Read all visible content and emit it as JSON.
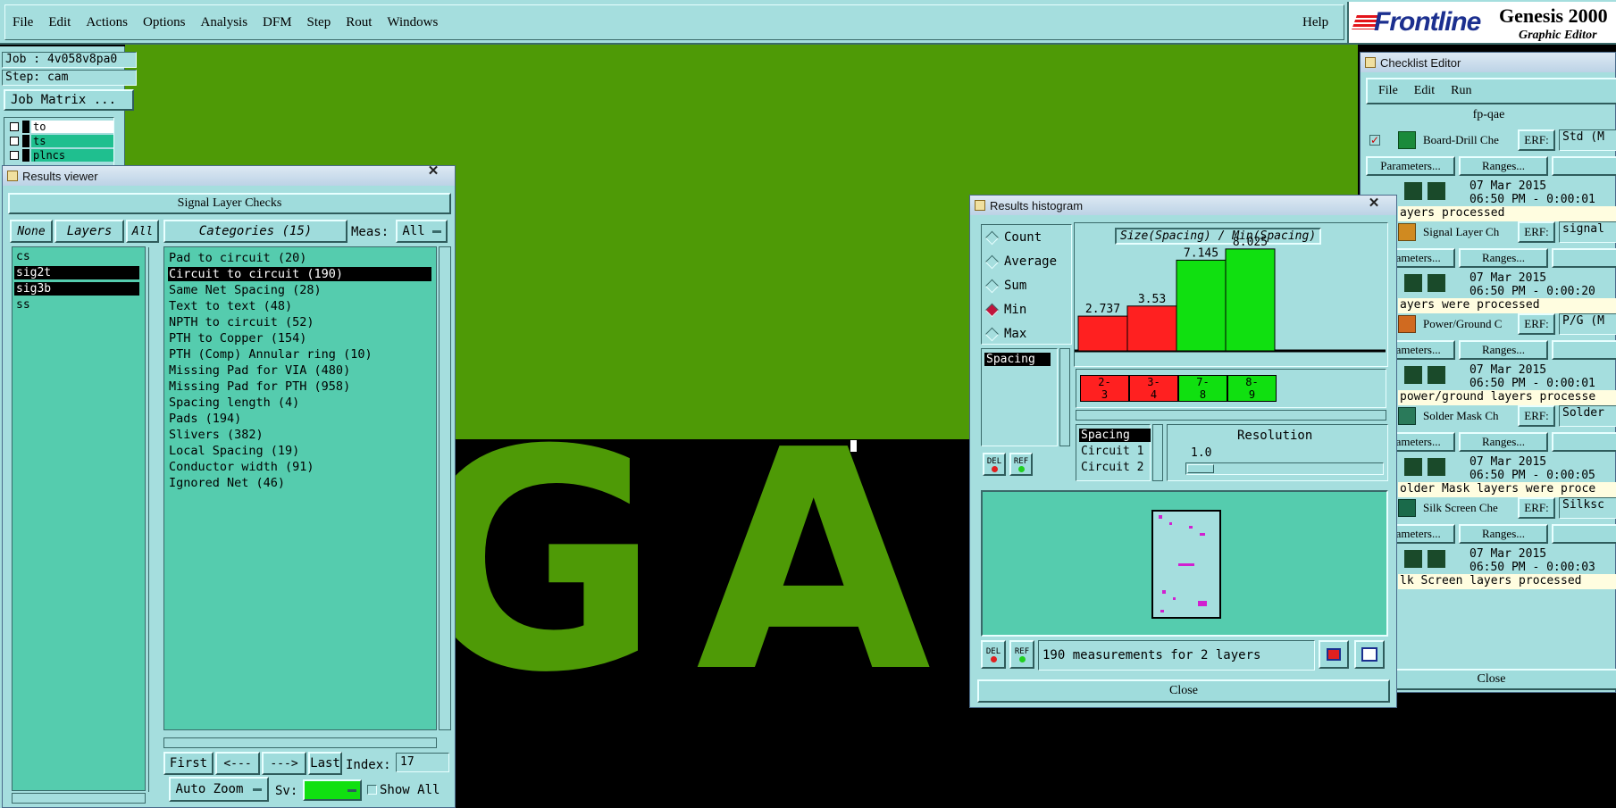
{
  "menubar": {
    "items": [
      "File",
      "Edit",
      "Actions",
      "Options",
      "Analysis",
      "DFM",
      "Step",
      "Rout",
      "Windows"
    ],
    "help": "Help",
    "logo": "Frontline",
    "product": "Genesis 2000",
    "subtitle": "Graphic Editor"
  },
  "left_panel": {
    "job": "Job : 4v058v8pa0",
    "step": "Step: cam",
    "job_matrix_button": "Job Matrix ...",
    "layers": [
      "to",
      "ts",
      "plncs"
    ]
  },
  "canvas": {
    "text": "GA1",
    "board_color": "#4e9a06"
  },
  "results_viewer": {
    "title": "Results viewer",
    "header": "Signal Layer Checks",
    "none_btn": "None",
    "layers_btn": "Layers",
    "all_btn": "All",
    "categories_btn": "Categories (15)",
    "meas_label": "Meas:",
    "meas_value": "All",
    "layer_list": [
      {
        "name": "cs",
        "selected": false
      },
      {
        "name": "sig2t",
        "selected": true
      },
      {
        "name": "sig3b",
        "selected": true
      },
      {
        "name": "ss",
        "selected": false
      }
    ],
    "categories": [
      {
        "label": "Pad to circuit (20)",
        "selected": false
      },
      {
        "label": "Circuit to circuit (190)",
        "selected": true
      },
      {
        "label": "Same Net Spacing (28)",
        "selected": false
      },
      {
        "label": "Text to text (48)",
        "selected": false
      },
      {
        "label": "NPTH to circuit (52)",
        "selected": false
      },
      {
        "label": "PTH to Copper (154)",
        "selected": false
      },
      {
        "label": "PTH (Comp) Annular ring (10)",
        "selected": false
      },
      {
        "label": "Missing Pad for VIA (480)",
        "selected": false
      },
      {
        "label": "Missing Pad for PTH (958)",
        "selected": false
      },
      {
        "label": "Spacing length (4)",
        "selected": false
      },
      {
        "label": "Pads (194)",
        "selected": false
      },
      {
        "label": "Slivers (382)",
        "selected": false
      },
      {
        "label": "Local Spacing (19)",
        "selected": false
      },
      {
        "label": "Conductor width (91)",
        "selected": false
      },
      {
        "label": "Ignored Net (46)",
        "selected": false
      }
    ],
    "nav": {
      "first": "First",
      "prev": "<---",
      "next": "--->",
      "last": "Last",
      "index_label": "Index:",
      "index_value": "17"
    },
    "auto_zoom": "Auto Zoom",
    "sv_label": "Sv:",
    "show_all": "Show All"
  },
  "histogram": {
    "title": "Results histogram",
    "modes": [
      {
        "label": "Count",
        "selected": false
      },
      {
        "label": "Average",
        "selected": false
      },
      {
        "label": "Sum",
        "selected": false
      },
      {
        "label": "Min",
        "selected": true
      },
      {
        "label": "Max",
        "selected": false
      }
    ],
    "spacing_list": [
      "Spacing"
    ],
    "chart_title": "Size(Spacing) / Min(Spacing)",
    "del": "DEL",
    "ref": "REF",
    "meas_list": [
      "Spacing",
      "Circuit 1",
      "Circuit 2"
    ],
    "resolution_label": "Resolution",
    "resolution_value": "1.0",
    "status": "190 measurements for 2 layers",
    "close": "Close"
  },
  "chart_data": {
    "type": "bar",
    "title": "Size(Spacing) / Min(Spacing)",
    "categories": [
      "2-3",
      "3-4",
      "7-8",
      "8-9"
    ],
    "category_lines": [
      [
        "2-",
        "3"
      ],
      [
        "3-",
        "4"
      ],
      [
        "7-",
        "8"
      ],
      [
        "8-",
        "9"
      ]
    ],
    "values": [
      2.737,
      3.53,
      7.145,
      8.025
    ],
    "value_labels": [
      "2.737",
      "3.53",
      "7.145",
      "8.025"
    ],
    "colors": [
      "#ff2020",
      "#ff2020",
      "#10e010",
      "#10e010"
    ],
    "ylim": [
      0,
      9
    ]
  },
  "checklist": {
    "title": "Checklist Editor",
    "menu": [
      "File",
      "Edit",
      "Run"
    ],
    "name": "fp-qae",
    "erf_label": "ERF:",
    "parameters_btn": "Parameters...",
    "ranges_btn": "Ranges...",
    "items": [
      {
        "name": "Board-Drill Che",
        "erf": "Std (M",
        "date": "07 Mar 2015",
        "time": "06:50 PM - 0:00:01",
        "status": "ayers processed"
      },
      {
        "name": "Signal Layer Ch",
        "erf": "signal",
        "date": "07 Mar 2015",
        "time": "06:50 PM - 0:00:20",
        "status": "ayers were processed"
      },
      {
        "name": "Power/Ground C",
        "erf": "P/G (M",
        "date": "07 Mar 2015",
        "time": "06:50 PM - 0:00:01",
        "status": "power/ground layers processe"
      },
      {
        "name": "Solder Mask Ch",
        "erf": "Solder",
        "date": "07 Mar 2015",
        "time": "06:50 PM - 0:00:05",
        "status": "older Mask layers were proce"
      },
      {
        "name": "Silk Screen Che",
        "erf": "Silksc",
        "date": "07 Mar 2015",
        "time": "06:50 PM - 0:00:03",
        "status": "lk Screen layers processed"
      }
    ],
    "close": "Close"
  }
}
